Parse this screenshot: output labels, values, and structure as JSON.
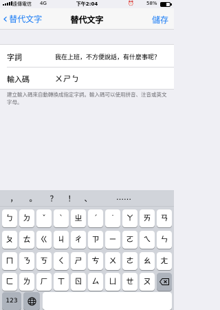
{
  "status": {
    "carrier": "遠傳電信",
    "network": "4G",
    "time": "下午2:04",
    "battery_pct": "58%",
    "battery_level": 0.58
  },
  "nav": {
    "back_label": "替代文字",
    "title": "替代文字",
    "save_label": "儲存"
  },
  "form": {
    "phrase_label": "字詞",
    "phrase_value": "我在上班，不方便說話，有什麼事呢？",
    "shortcut_label": "輸入碼",
    "shortcut_value": "ㄨㄕㄅ"
  },
  "hint": "建立輸入碼來自動轉換成指定字詞。輸入碼可以使用拼音、注音或英文字母。",
  "keyboard": {
    "suggestions": [
      "，",
      "。",
      "？",
      "！",
      "、",
      "……"
    ],
    "row1": [
      "ㄅ",
      "ㄉ",
      "ˇ",
      "ˋ",
      "ㄓ",
      "ˊ",
      "˙",
      "ㄚ",
      "ㄞ",
      "ㄢ"
    ],
    "row2": [
      "ㄆ",
      "ㄊ",
      "ㄍ",
      "ㄐ",
      "ㄔ",
      "ㄗ",
      "ㄧ",
      "ㄛ",
      "ㄟ",
      "ㄣ"
    ],
    "row3": [
      "ㄇ",
      "ㄋ",
      "ㄎ",
      "ㄑ",
      "ㄕ",
      "ㄘ",
      "ㄨ",
      "ㄜ",
      "ㄠ",
      "ㄤ"
    ],
    "row4": [
      "ㄈ",
      "ㄌ",
      "ㄏ",
      "ㄒ",
      "ㄖ",
      "ㄙ",
      "ㄩ",
      "ㄝ",
      "ㄡ"
    ],
    "numbers_key": "123",
    "globe_icon": "globe-icon",
    "delete_icon": "delete-icon"
  },
  "colors": {
    "accent": "#1a7cf5"
  }
}
